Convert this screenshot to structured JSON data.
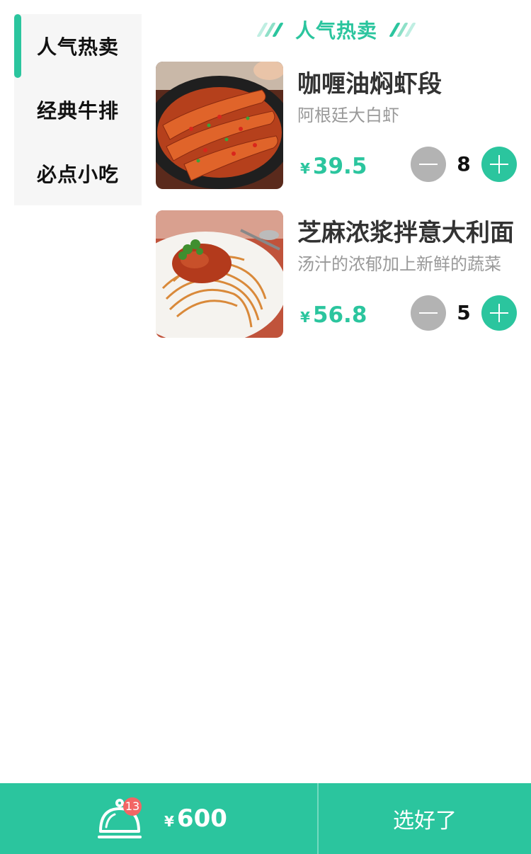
{
  "sidebar": {
    "items": [
      {
        "label": "人气热卖",
        "active": true
      },
      {
        "label": "经典牛排",
        "active": false
      },
      {
        "label": "必点小吃",
        "active": false
      }
    ]
  },
  "section": {
    "title": "人气热卖"
  },
  "currency_symbol": "¥",
  "dishes": [
    {
      "name": "咖喱油焖虾段",
      "description": "阿根廷大白虾",
      "price": "39.5",
      "quantity": "8",
      "image": "mantis-shrimp-in-pan"
    },
    {
      "name": "芝麻浓浆拌意大利面",
      "description": "汤汁的浓郁加上新鲜的蔬菜",
      "price": "56.8",
      "quantity": "5",
      "image": "spaghetti-bolognese-plate"
    }
  ],
  "footer": {
    "cart_count": "13",
    "total": "600",
    "checkout_label": "选好了"
  },
  "colors": {
    "accent": "#2bc59e",
    "badge": "#f26665",
    "minus": "#b3b3b3"
  }
}
